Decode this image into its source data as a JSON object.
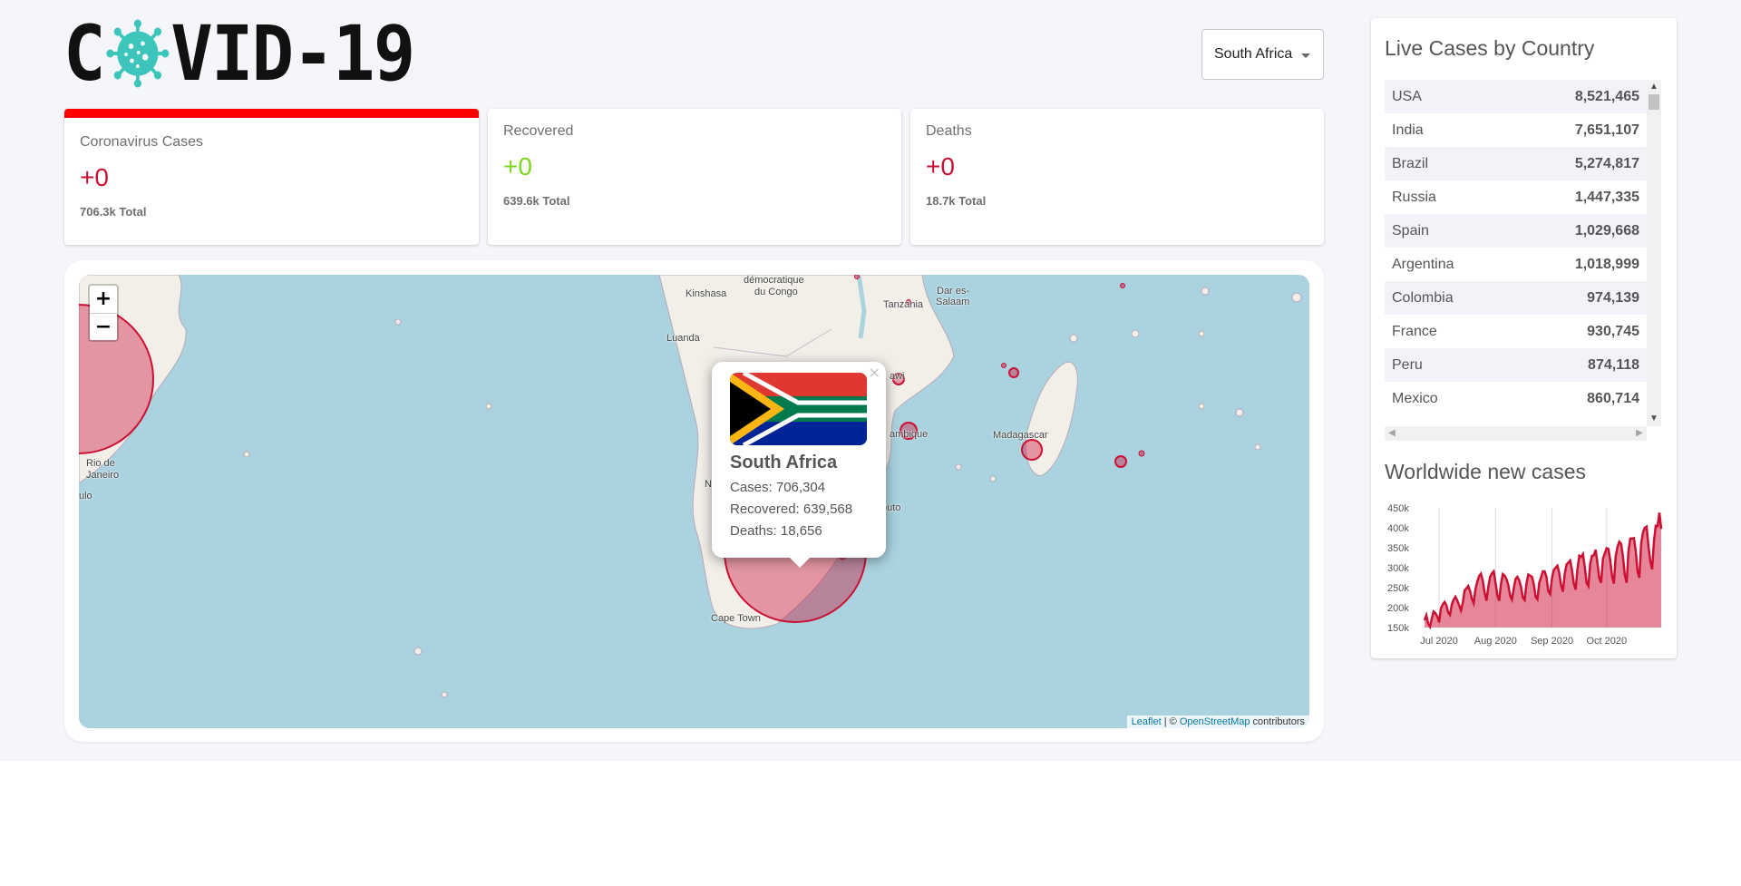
{
  "header": {
    "logo_text_left": "C",
    "logo_text_right": "VID-19",
    "country_select": {
      "selected": "South Africa"
    }
  },
  "info_boxes": [
    {
      "title": "Coronavirus Cases",
      "value": "+0",
      "total": "706.3k Total"
    },
    {
      "title": "Recovered",
      "value": "+0",
      "total": "639.6k Total"
    },
    {
      "title": "Deaths",
      "value": "+0",
      "total": "18.7k Total"
    }
  ],
  "map": {
    "zoom_in": "+",
    "zoom_out": "−",
    "labels": {
      "rdc": "démocratique",
      "congo": "du Congo",
      "kinshasa": "Kinshasa",
      "luanda": "Luanda",
      "tanzania": "Tanzania",
      "dar": "Dar es-",
      "salaam": "Salaam",
      "malawi": "awi",
      "mozambique": "ambique",
      "madagascar": "Madagascar",
      "maputo": "puto",
      "cape_town": "Cape Town",
      "rio_1": "Rio de",
      "rio_2": "Janeiro",
      "sp": "ulo",
      "n": "N"
    },
    "popup": {
      "close": "×",
      "country": "South Africa",
      "cases": "Cases: 706,304",
      "recovered": "Recovered: 639,568",
      "deaths": "Deaths: 18,656"
    },
    "attribution": {
      "leaflet": "Leaflet",
      "sep": " | © ",
      "osm": "OpenStreetMap",
      "suffix": " contributors"
    }
  },
  "colors": {
    "cases": "#cc1034",
    "recovered": "#7dd71d",
    "deaths": "#cc1034",
    "active_border": "#ff0000",
    "map_water": "#aad3df"
  },
  "live_cases": {
    "title": "Live Cases by Country",
    "rows": [
      {
        "country": "USA",
        "cases": "8,521,465"
      },
      {
        "country": "India",
        "cases": "7,651,107"
      },
      {
        "country": "Brazil",
        "cases": "5,274,817"
      },
      {
        "country": "Russia",
        "cases": "1,447,335"
      },
      {
        "country": "Spain",
        "cases": "1,029,668"
      },
      {
        "country": "Argentina",
        "cases": "1,018,999"
      },
      {
        "country": "Colombia",
        "cases": "974,139"
      },
      {
        "country": "France",
        "cases": "930,745"
      },
      {
        "country": "Peru",
        "cases": "874,118"
      },
      {
        "country": "Mexico",
        "cases": "860,714"
      }
    ]
  },
  "worldwide": {
    "title": "Worldwide new cases"
  },
  "chart_data": {
    "type": "area",
    "title": "Worldwide new cases",
    "xlabel": "",
    "ylabel": "",
    "x_ticks": [
      "Jul 2020",
      "Aug 2020",
      "Sep 2020",
      "Oct 2020"
    ],
    "y_ticks": [
      "150k",
      "200k",
      "250k",
      "300k",
      "350k",
      "400k",
      "450k"
    ],
    "ylim": [
      150000,
      450000
    ],
    "x_start": "2020-06-23",
    "grid": "vertical",
    "color": "#cc1034",
    "values": [
      168000,
      181000,
      160000,
      152000,
      173000,
      190000,
      186000,
      178000,
      163000,
      198000,
      208000,
      214000,
      206000,
      188000,
      182000,
      208000,
      220000,
      227000,
      218000,
      206000,
      193000,
      212000,
      243000,
      248000,
      254000,
      242000,
      222000,
      211000,
      247000,
      265000,
      279000,
      285000,
      268000,
      237000,
      217000,
      252000,
      277000,
      286000,
      291000,
      262000,
      231000,
      217000,
      259000,
      284000,
      280000,
      272000,
      256000,
      230000,
      220000,
      248000,
      272000,
      277000,
      268000,
      252000,
      225000,
      219000,
      260000,
      283000,
      280000,
      277000,
      258000,
      227000,
      221000,
      262000,
      276000,
      291000,
      291000,
      276000,
      241000,
      234000,
      273000,
      294000,
      300000,
      305000,
      286000,
      256000,
      240000,
      284000,
      308000,
      313000,
      318000,
      294000,
      261000,
      245000,
      296000,
      330000,
      327000,
      334000,
      302000,
      262000,
      254000,
      310000,
      330000,
      331000,
      345000,
      311000,
      274000,
      262000,
      323000,
      336000,
      349000,
      347000,
      318000,
      279000,
      260000,
      329000,
      352000,
      365000,
      360000,
      328000,
      283000,
      262000,
      341000,
      373000,
      373000,
      374000,
      342000,
      291000,
      275000,
      360000,
      388000,
      400000,
      403000,
      355000,
      316000,
      296000,
      366000,
      405000,
      404000,
      438000,
      397000
    ]
  }
}
